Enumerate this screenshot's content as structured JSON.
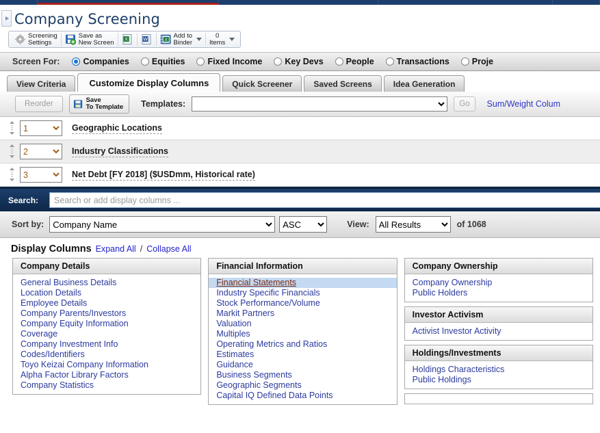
{
  "window": {
    "title": "Company Screening",
    "collapse_icon": "collapse-arrow-icon"
  },
  "toolbar": {
    "screening_settings_line1": "Screening",
    "screening_settings_line2": "Settings",
    "save_as_new_line1": "Save as",
    "save_as_new_line2": "New Screen",
    "excel_icon": "export-excel-icon",
    "word_icon": "export-word-icon",
    "add_to_binder_line1": "Add to",
    "add_to_binder_line2": "Binder",
    "items_count": "0",
    "items_label": "Items"
  },
  "screen_for": {
    "label": "Screen For:",
    "options": [
      {
        "label": "Companies",
        "selected": true
      },
      {
        "label": "Equities",
        "selected": false
      },
      {
        "label": "Fixed Income",
        "selected": false
      },
      {
        "label": "Key Devs",
        "selected": false
      },
      {
        "label": "People",
        "selected": false
      },
      {
        "label": "Transactions",
        "selected": false
      },
      {
        "label": "Proje",
        "selected": false
      }
    ]
  },
  "tabs": [
    {
      "label": "View Criteria",
      "active": false
    },
    {
      "label": "Customize Display Columns",
      "active": true
    },
    {
      "label": "Quick Screener",
      "active": false
    },
    {
      "label": "Saved Screens",
      "active": false
    },
    {
      "label": "Idea Generation",
      "active": false
    }
  ],
  "templates_bar": {
    "reorder_label": "Reorder",
    "save_to_template_line1": "Save",
    "save_to_template_line2": "To Template",
    "templates_label": "Templates:",
    "templates_value": "",
    "go_label": "Go",
    "sum_weight_link": "Sum/Weight Colum"
  },
  "column_rows": [
    {
      "order": "1",
      "name": "Geographic Locations"
    },
    {
      "order": "2",
      "name": "Industry Classifications"
    },
    {
      "order": "3",
      "name": "Net Debt [FY 2018] ($USDmm, Historical rate)"
    }
  ],
  "search": {
    "label": "Search:",
    "placeholder": "Search or add display columns ...",
    "value": ""
  },
  "sort_bar": {
    "sort_by_label": "Sort by:",
    "sort_by_value": "Company Name",
    "direction_value": "ASC",
    "view_label": "View:",
    "view_value": "All Results",
    "of_count": "of 1068"
  },
  "display_columns": {
    "title": "Display Columns",
    "expand_all": "Expand All",
    "separator": "/",
    "collapse_all": "Collapse All",
    "columns": [
      {
        "panels": [
          {
            "heading": "Company Details",
            "links": [
              {
                "label": "General Business Details",
                "selected": false
              },
              {
                "label": "Location Details",
                "selected": false
              },
              {
                "label": "Employee Details",
                "selected": false
              },
              {
                "label": "Company Parents/Investors",
                "selected": false
              },
              {
                "label": "Company Equity Information",
                "selected": false
              },
              {
                "label": "Coverage",
                "selected": false
              },
              {
                "label": "Company Investment Info",
                "selected": false
              },
              {
                "label": "Codes/Identifiers",
                "selected": false
              },
              {
                "label": "Toyo Keizai Company Information",
                "selected": false
              },
              {
                "label": "Alpha Factor Library Factors",
                "selected": false
              },
              {
                "label": "Company Statistics",
                "selected": false
              }
            ]
          }
        ]
      },
      {
        "panels": [
          {
            "heading": "Financial Information",
            "links": [
              {
                "label": "Financial Statements",
                "selected": true
              },
              {
                "label": "Industry Specific Financials",
                "selected": false
              },
              {
                "label": "Stock Performance/Volume",
                "selected": false
              },
              {
                "label": "Markit Partners",
                "selected": false
              },
              {
                "label": "Valuation",
                "selected": false
              },
              {
                "label": "Multiples",
                "selected": false
              },
              {
                "label": "Operating Metrics and Ratios",
                "selected": false
              },
              {
                "label": "Estimates",
                "selected": false
              },
              {
                "label": "Guidance",
                "selected": false
              },
              {
                "label": "Business Segments",
                "selected": false
              },
              {
                "label": "Geographic Segments",
                "selected": false
              },
              {
                "label": "Capital IQ Defined Data Points",
                "selected": false
              }
            ]
          }
        ]
      },
      {
        "panels": [
          {
            "heading": "Company Ownership",
            "links": [
              {
                "label": "Company Ownership",
                "selected": false
              },
              {
                "label": "Public Holders",
                "selected": false
              }
            ]
          },
          {
            "heading": "Investor Activism",
            "links": [
              {
                "label": "Activist Investor Activity",
                "selected": false
              }
            ]
          },
          {
            "heading": "Holdings/Investments",
            "links": [
              {
                "label": "Holdings Characteristics",
                "selected": false
              },
              {
                "label": "Public Holdings",
                "selected": false
              }
            ]
          }
        ]
      }
    ]
  }
}
